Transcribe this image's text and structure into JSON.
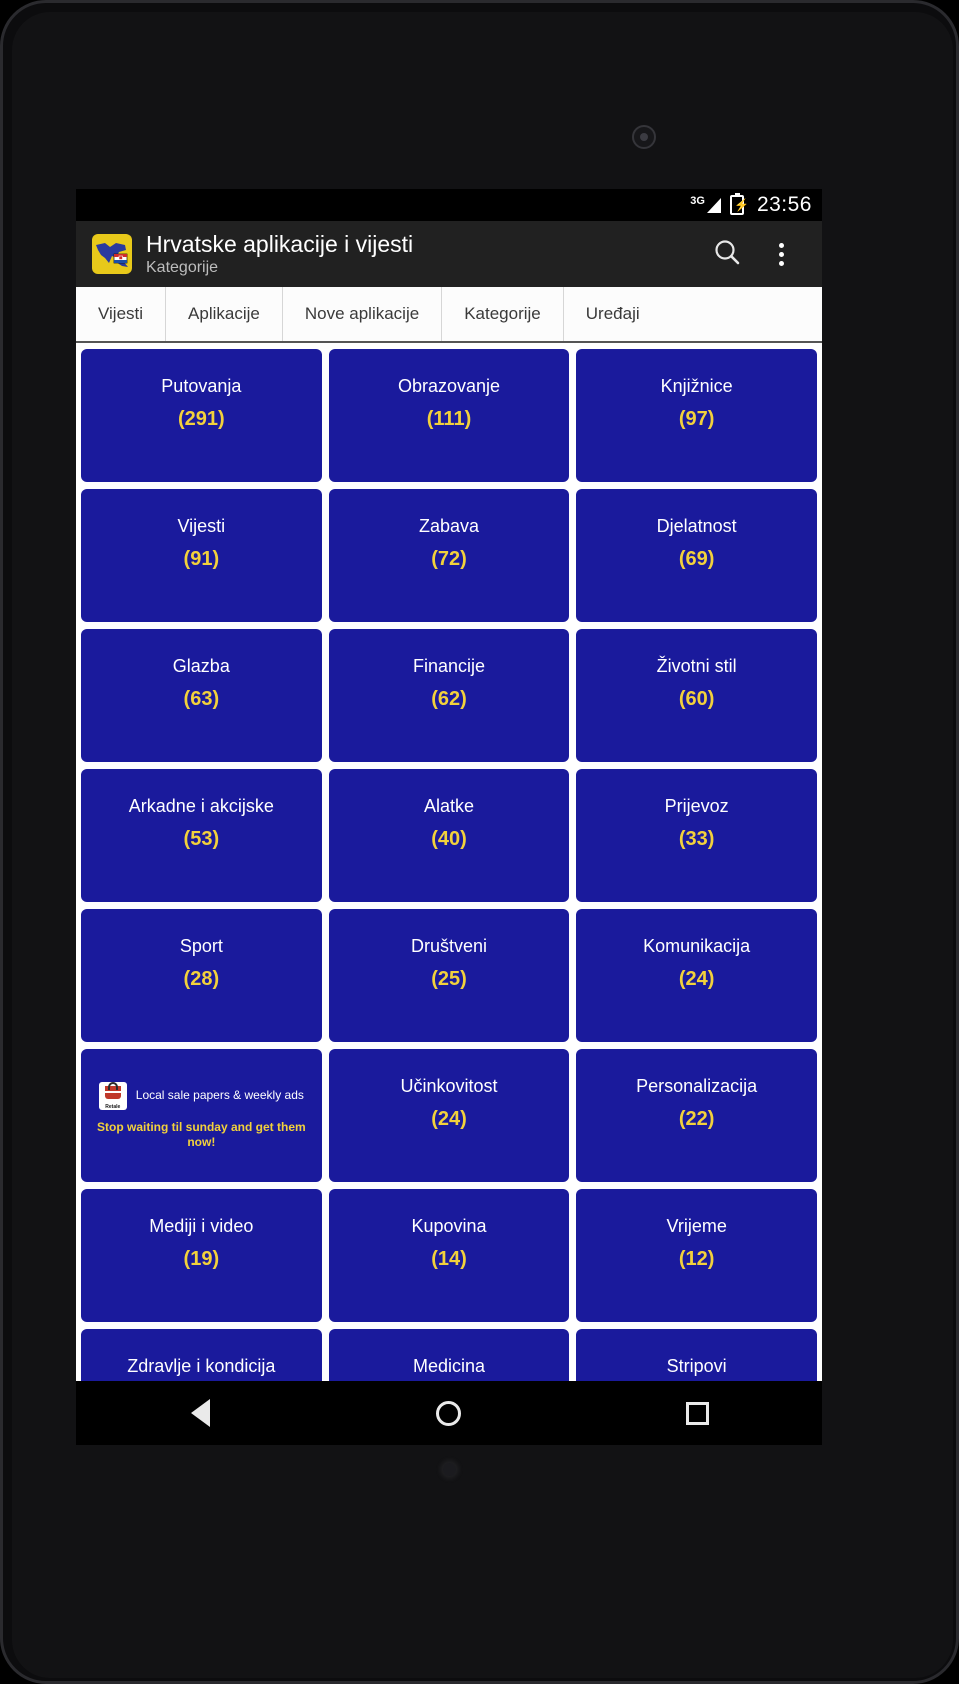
{
  "status_bar": {
    "network_type": "3G",
    "clock": "23:56",
    "signal_icon": "signal-bars-icon",
    "battery_icon": "battery-charging-icon"
  },
  "action_bar": {
    "app_icon": "croatia-map-icon",
    "title": "Hrvatske aplikacije i vijesti",
    "subtitle": "Kategorije",
    "search_icon": "search-icon",
    "overflow_icon": "overflow-menu-icon"
  },
  "tabs": [
    {
      "label": "Vijesti"
    },
    {
      "label": "Aplikacije"
    },
    {
      "label": "Nove aplikacije"
    },
    {
      "label": "Kategorije"
    },
    {
      "label": "Uređaji"
    }
  ],
  "active_tab": "Kategorije",
  "colors": {
    "tile_background": "#1a1a9c",
    "tile_title": "#ffffff",
    "tile_count": "#f2d13c",
    "action_bar": "#212121",
    "accent_yellow": "#e8c91a"
  },
  "categories": [
    {
      "name": "Putovanja",
      "count": "(291)"
    },
    {
      "name": "Obrazovanje",
      "count": "(111)"
    },
    {
      "name": "Knjižnice",
      "count": "(97)"
    },
    {
      "name": "Vijesti",
      "count": "(91)"
    },
    {
      "name": "Zabava",
      "count": "(72)"
    },
    {
      "name": "Djelatnost",
      "count": "(69)"
    },
    {
      "name": "Glazba",
      "count": "(63)"
    },
    {
      "name": "Financije",
      "count": "(62)"
    },
    {
      "name": "Životni stil",
      "count": "(60)"
    },
    {
      "name": "Arkadne i akcijske",
      "count": "(53)"
    },
    {
      "name": "Alatke",
      "count": "(40)"
    },
    {
      "name": "Prijevoz",
      "count": "(33)"
    },
    {
      "name": "Sport",
      "count": "(28)"
    },
    {
      "name": "Društveni",
      "count": "(25)"
    },
    {
      "name": "Komunikacija",
      "count": "(24)"
    },
    {
      "name": "Učinkovitost",
      "count": "(24)"
    },
    {
      "name": "Personalizacija",
      "count": "(22)"
    },
    {
      "name": "Mediji i video",
      "count": "(19)"
    },
    {
      "name": "Kupovina",
      "count": "(14)"
    },
    {
      "name": "Vrijeme",
      "count": "(12)"
    },
    {
      "name": "Zdravlje i kondicija",
      "count": ""
    },
    {
      "name": "Medicina",
      "count": ""
    },
    {
      "name": "Stripovi",
      "count": ""
    }
  ],
  "ad_tile": {
    "badge_icon": "shopping-bag-icon",
    "badge_word": "Retale",
    "line1": "Local sale papers & weekly ads",
    "line2": "Stop waiting til sunday and get them now!"
  },
  "nav_bar": {
    "back_icon": "back-triangle-icon",
    "home_icon": "home-circle-icon",
    "recents_icon": "recents-square-icon"
  }
}
